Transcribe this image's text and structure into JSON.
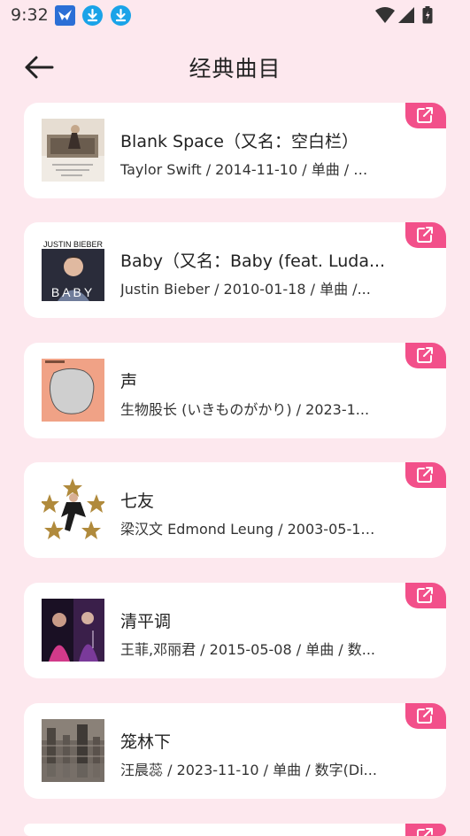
{
  "status": {
    "time": "9:32"
  },
  "header": {
    "title": "经典曲目"
  },
  "songs": [
    {
      "title": "Blank Space（又名：空白栏）",
      "meta": "Taylor Swift / 2014-11-10 / 单曲 / 数..."
    },
    {
      "title": "Baby（又名：Baby (feat. Luda...",
      "meta": "Justin Bieber / 2010-01-18 / 单曲 /...",
      "cover_text_top": "JUSTIN BIEBER",
      "cover_text_bottom": "BABY"
    },
    {
      "title": "声",
      "meta": "生物股长 (いきものがかり) / 2023-1..."
    },
    {
      "title": "七友",
      "meta": "梁汉文 Edmond Leung / 2003-05-16..."
    },
    {
      "title": "清平调",
      "meta": "王菲,邓丽君 / 2015-05-08 / 单曲 / 数..."
    },
    {
      "title": "笼林下",
      "meta": "汪晨蕊 / 2023-11-10 / 单曲 / 数字(Di..."
    }
  ],
  "colors": {
    "accent": "#f2508a",
    "background": "#fde8ee",
    "card": "#ffffff"
  },
  "icons": {
    "back": "arrow-left-icon",
    "share": "external-link-icon"
  }
}
